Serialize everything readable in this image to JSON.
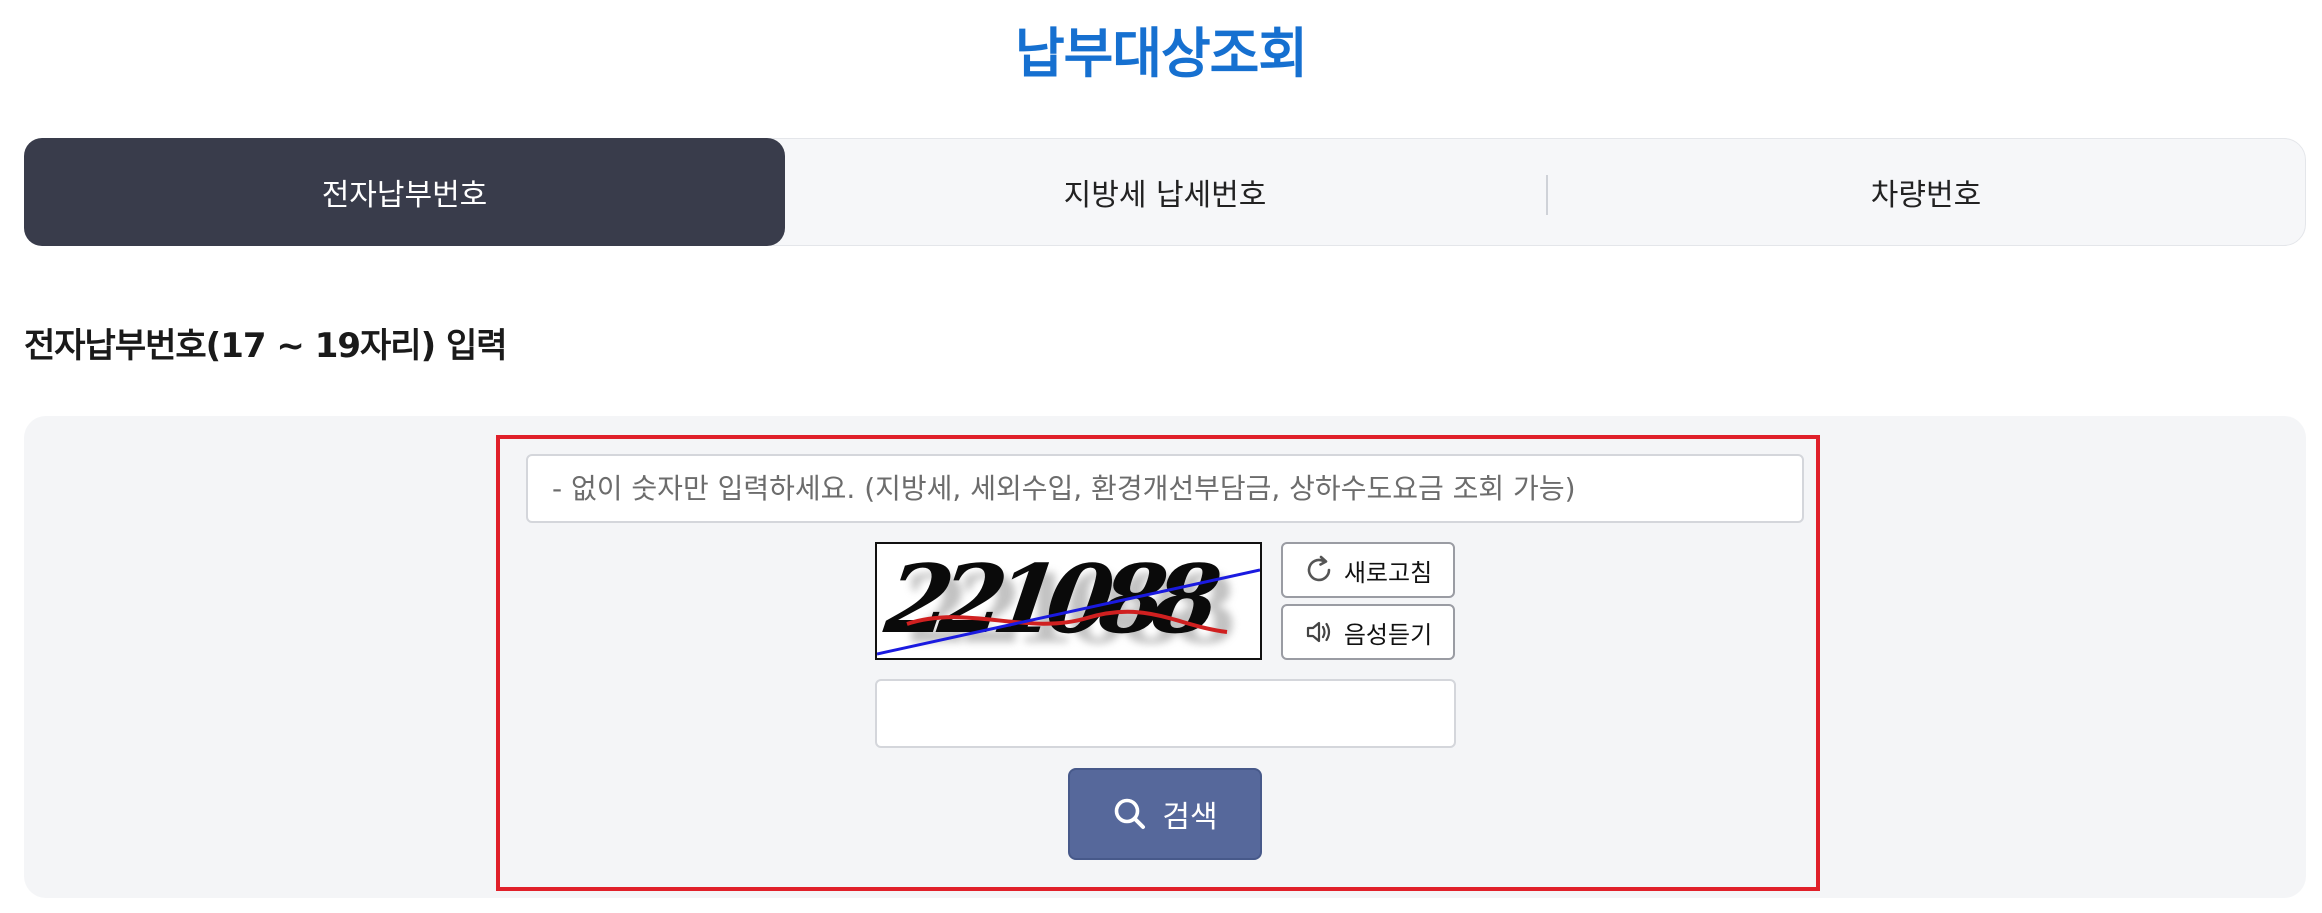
{
  "page": {
    "title": "납부대상조회"
  },
  "tabs": [
    {
      "label": "전자납부번호",
      "active": true
    },
    {
      "label": "지방세 납세번호",
      "active": false
    },
    {
      "label": "차량번호",
      "active": false
    }
  ],
  "section": {
    "heading": "전자납부번호(17 ~ 19자리) 입력"
  },
  "form": {
    "number_input": {
      "value": "",
      "placeholder": "- 없이 숫자만 입력하세요. (지방세, 세외수입, 환경개선부담금, 상하수도요금 조회 가능)"
    },
    "captcha": {
      "text": "221088",
      "icon": "captcha-image"
    },
    "refresh_label": "새로고침",
    "refresh_icon": "refresh-icon",
    "audio_label": "음성듣기",
    "audio_icon": "speaker-icon",
    "captcha_input": {
      "value": "",
      "placeholder": ""
    },
    "search_label": "검색",
    "search_icon": "search-icon"
  },
  "colors": {
    "title": "#1670d0",
    "active_tab": "#393c4b",
    "search_button": "#56689b",
    "highlight_border": "#e0202a"
  }
}
